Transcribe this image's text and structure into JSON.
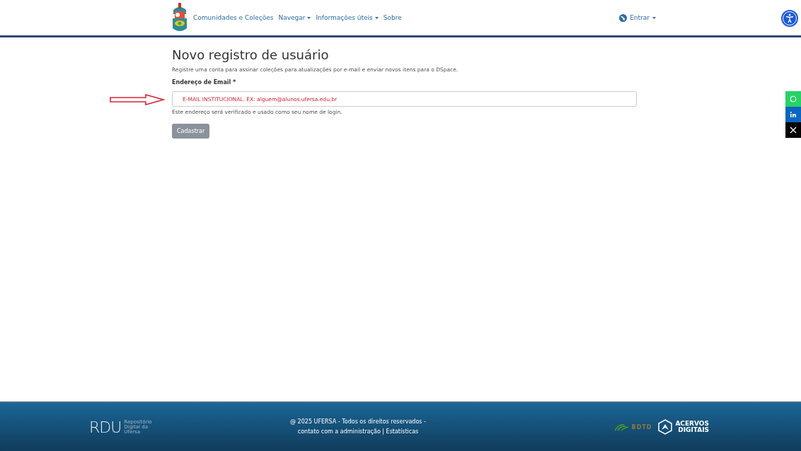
{
  "navbar": {
    "links": [
      {
        "label": "Comunidades e Coleções",
        "dropdown": false
      },
      {
        "label": "Navegar",
        "dropdown": true
      },
      {
        "label": "Informações úteis",
        "dropdown": true
      },
      {
        "label": "Sobre",
        "dropdown": false
      }
    ],
    "login": {
      "label": "Entrar",
      "dropdown": true
    }
  },
  "form": {
    "title": "Novo registro de usuário",
    "description": "Registre uma conta para assinar coleções para atualizações por e-mail e enviar novos itens para o DSpace.",
    "email_label": "Endereço de Email *",
    "email_placeholder": "E-MAIL INSTITUCIONAL. EX: alguem@alunos.ufersa.edu.br",
    "help": "Este endereço será verificado e usado como seu nome de login.",
    "submit": {
      "label": "Cadastrar",
      "disabled": true
    }
  },
  "share_buttons": [
    {
      "kind": "whatsapp",
      "color": "#25d366"
    },
    {
      "kind": "linkedin",
      "color": "#0a66c2"
    },
    {
      "kind": "x",
      "color": "#000000"
    }
  ],
  "footer": {
    "logo": {
      "acronym": "RDU",
      "subtitle": [
        "Repositório",
        "Digital da",
        "Ufersa"
      ]
    },
    "copyright": "@ 2025 UFERSA - Todos os direitos reservados -",
    "links": [
      "contato com a administração",
      "Estatísticas"
    ],
    "link_separator": "|",
    "partners": {
      "bdtd": "BDTD",
      "acervos": [
        "ACERVOS",
        "DIGITAIS"
      ]
    }
  }
}
